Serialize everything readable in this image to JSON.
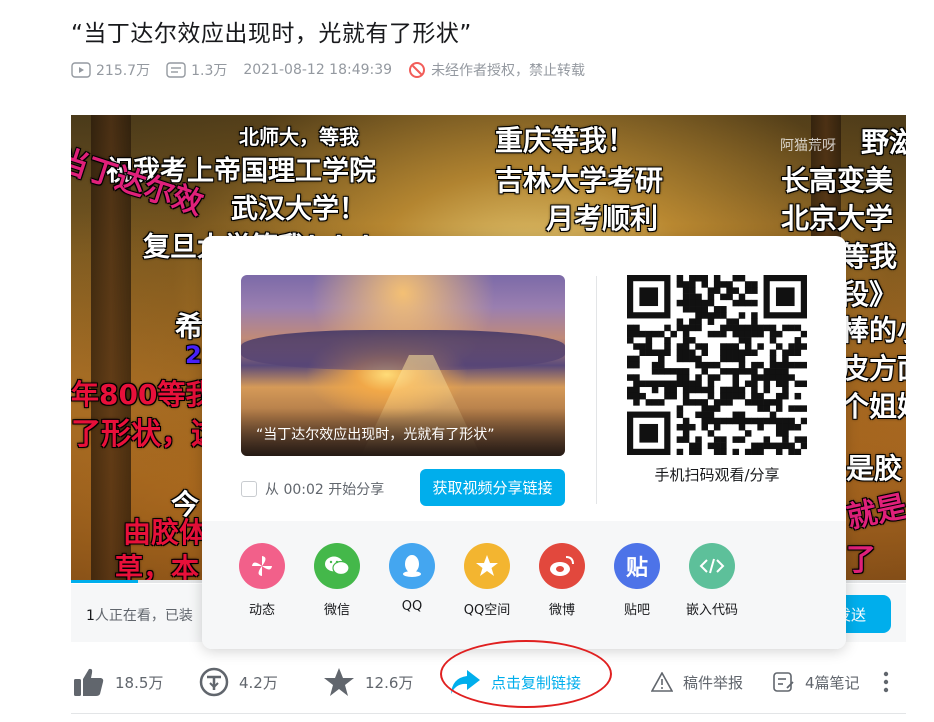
{
  "video_title": "“当丁达尔效应出现时，光就有了形状”",
  "meta": {
    "plays": "215.7万",
    "danmaku": "1.3万",
    "datetime": "2021-08-12 18:49:39",
    "copyright_notice": "未经作者授权，禁止转载"
  },
  "video": {
    "watermark": "阿猫荒呀",
    "danmaku_lines": [
      "北师大，等我",
      "祝我考上帝国理工学院",
      "武汉大学！",
      "复旦大学等我！！！",
      "重庆等我！",
      "吉林大学考研",
      "月考顺利",
      "野滋",
      "长高变美",
      "北京大学",
      "等我",
      "当丁达尔效",
      "希",
      "2",
      "年800等我",
      "了形状，这",
      "今",
      "由胶体",
      "草，本",
      "段》",
      "棒的小",
      "皮方面",
      "个姐妹",
      "是胶",
      "就是",
      "了"
    ],
    "progress_fraction": 0.08
  },
  "bottom_bar": {
    "viewers_count": "1",
    "viewers_text": "人正在看，已装",
    "send_label": "发送"
  },
  "share_panel": {
    "thumbnail_caption": "“当丁达尔效应出现时，光就有了形状”",
    "start_from_label": "从 00:02 开始分享",
    "get_link_button": "获取视频分享链接",
    "qr_label": "手机扫码观看/分享",
    "targets": [
      {
        "label": "动态",
        "color": "#f2608a",
        "icon": "pinwheel-icon"
      },
      {
        "label": "微信",
        "color": "#44b84a",
        "icon": "wechat-icon"
      },
      {
        "label": "QQ",
        "color": "#44a6f0",
        "icon": "qq-icon"
      },
      {
        "label": "QQ空间",
        "color": "#f3b530",
        "icon": "qzone-star-icon"
      },
      {
        "label": "微博",
        "color": "#e2483d",
        "icon": "weibo-icon"
      },
      {
        "label": "贴吧",
        "color": "#4d73e8",
        "icon": "tieba-icon"
      },
      {
        "label": "嵌入代码",
        "color": "#5dc09a",
        "icon": "code-icon"
      }
    ]
  },
  "actions": {
    "like": "18.5万",
    "coin": "4.2万",
    "favorite": "12.6万",
    "copy_link": "点击复制链接",
    "report": "稿件举报",
    "notes": "4篇笔记"
  }
}
